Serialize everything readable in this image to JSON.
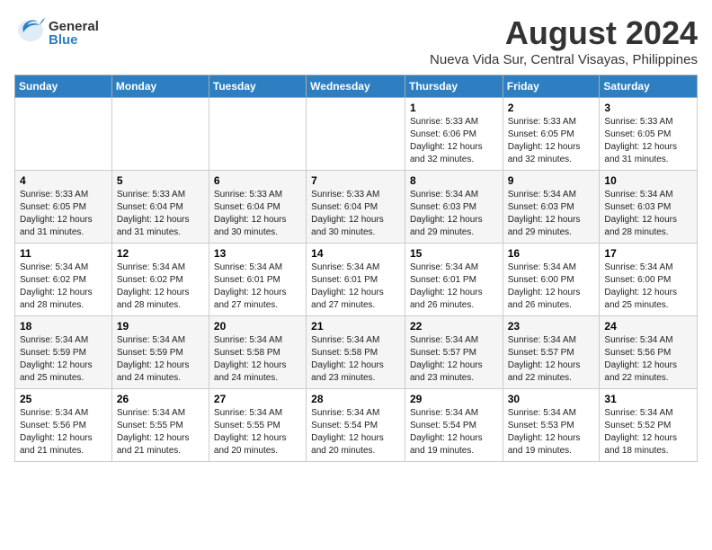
{
  "header": {
    "logo_general": "General",
    "logo_blue": "Blue",
    "month_year": "August 2024",
    "location": "Nueva Vida Sur, Central Visayas, Philippines"
  },
  "days_of_week": [
    "Sunday",
    "Monday",
    "Tuesday",
    "Wednesday",
    "Thursday",
    "Friday",
    "Saturday"
  ],
  "weeks": [
    {
      "days": [
        {
          "number": "",
          "info": ""
        },
        {
          "number": "",
          "info": ""
        },
        {
          "number": "",
          "info": ""
        },
        {
          "number": "",
          "info": ""
        },
        {
          "number": "1",
          "sunrise": "5:33 AM",
          "sunset": "6:06 PM",
          "daylight": "12 hours and 32 minutes."
        },
        {
          "number": "2",
          "sunrise": "5:33 AM",
          "sunset": "6:05 PM",
          "daylight": "12 hours and 32 minutes."
        },
        {
          "number": "3",
          "sunrise": "5:33 AM",
          "sunset": "6:05 PM",
          "daylight": "12 hours and 31 minutes."
        }
      ]
    },
    {
      "days": [
        {
          "number": "4",
          "sunrise": "5:33 AM",
          "sunset": "6:05 PM",
          "daylight": "12 hours and 31 minutes."
        },
        {
          "number": "5",
          "sunrise": "5:33 AM",
          "sunset": "6:04 PM",
          "daylight": "12 hours and 31 minutes."
        },
        {
          "number": "6",
          "sunrise": "5:33 AM",
          "sunset": "6:04 PM",
          "daylight": "12 hours and 30 minutes."
        },
        {
          "number": "7",
          "sunrise": "5:33 AM",
          "sunset": "6:04 PM",
          "daylight": "12 hours and 30 minutes."
        },
        {
          "number": "8",
          "sunrise": "5:34 AM",
          "sunset": "6:03 PM",
          "daylight": "12 hours and 29 minutes."
        },
        {
          "number": "9",
          "sunrise": "5:34 AM",
          "sunset": "6:03 PM",
          "daylight": "12 hours and 29 minutes."
        },
        {
          "number": "10",
          "sunrise": "5:34 AM",
          "sunset": "6:03 PM",
          "daylight": "12 hours and 28 minutes."
        }
      ]
    },
    {
      "days": [
        {
          "number": "11",
          "sunrise": "5:34 AM",
          "sunset": "6:02 PM",
          "daylight": "12 hours and 28 minutes."
        },
        {
          "number": "12",
          "sunrise": "5:34 AM",
          "sunset": "6:02 PM",
          "daylight": "12 hours and 28 minutes."
        },
        {
          "number": "13",
          "sunrise": "5:34 AM",
          "sunset": "6:01 PM",
          "daylight": "12 hours and 27 minutes."
        },
        {
          "number": "14",
          "sunrise": "5:34 AM",
          "sunset": "6:01 PM",
          "daylight": "12 hours and 27 minutes."
        },
        {
          "number": "15",
          "sunrise": "5:34 AM",
          "sunset": "6:01 PM",
          "daylight": "12 hours and 26 minutes."
        },
        {
          "number": "16",
          "sunrise": "5:34 AM",
          "sunset": "6:00 PM",
          "daylight": "12 hours and 26 minutes."
        },
        {
          "number": "17",
          "sunrise": "5:34 AM",
          "sunset": "6:00 PM",
          "daylight": "12 hours and 25 minutes."
        }
      ]
    },
    {
      "days": [
        {
          "number": "18",
          "sunrise": "5:34 AM",
          "sunset": "5:59 PM",
          "daylight": "12 hours and 25 minutes."
        },
        {
          "number": "19",
          "sunrise": "5:34 AM",
          "sunset": "5:59 PM",
          "daylight": "12 hours and 24 minutes."
        },
        {
          "number": "20",
          "sunrise": "5:34 AM",
          "sunset": "5:58 PM",
          "daylight": "12 hours and 24 minutes."
        },
        {
          "number": "21",
          "sunrise": "5:34 AM",
          "sunset": "5:58 PM",
          "daylight": "12 hours and 23 minutes."
        },
        {
          "number": "22",
          "sunrise": "5:34 AM",
          "sunset": "5:57 PM",
          "daylight": "12 hours and 23 minutes."
        },
        {
          "number": "23",
          "sunrise": "5:34 AM",
          "sunset": "5:57 PM",
          "daylight": "12 hours and 22 minutes."
        },
        {
          "number": "24",
          "sunrise": "5:34 AM",
          "sunset": "5:56 PM",
          "daylight": "12 hours and 22 minutes."
        }
      ]
    },
    {
      "days": [
        {
          "number": "25",
          "sunrise": "5:34 AM",
          "sunset": "5:56 PM",
          "daylight": "12 hours and 21 minutes."
        },
        {
          "number": "26",
          "sunrise": "5:34 AM",
          "sunset": "5:55 PM",
          "daylight": "12 hours and 21 minutes."
        },
        {
          "number": "27",
          "sunrise": "5:34 AM",
          "sunset": "5:55 PM",
          "daylight": "12 hours and 20 minutes."
        },
        {
          "number": "28",
          "sunrise": "5:34 AM",
          "sunset": "5:54 PM",
          "daylight": "12 hours and 20 minutes."
        },
        {
          "number": "29",
          "sunrise": "5:34 AM",
          "sunset": "5:54 PM",
          "daylight": "12 hours and 19 minutes."
        },
        {
          "number": "30",
          "sunrise": "5:34 AM",
          "sunset": "5:53 PM",
          "daylight": "12 hours and 19 minutes."
        },
        {
          "number": "31",
          "sunrise": "5:34 AM",
          "sunset": "5:52 PM",
          "daylight": "12 hours and 18 minutes."
        }
      ]
    }
  ],
  "labels": {
    "sunrise_prefix": "Sunrise: ",
    "sunset_prefix": "Sunset: ",
    "daylight_prefix": "Daylight: "
  }
}
